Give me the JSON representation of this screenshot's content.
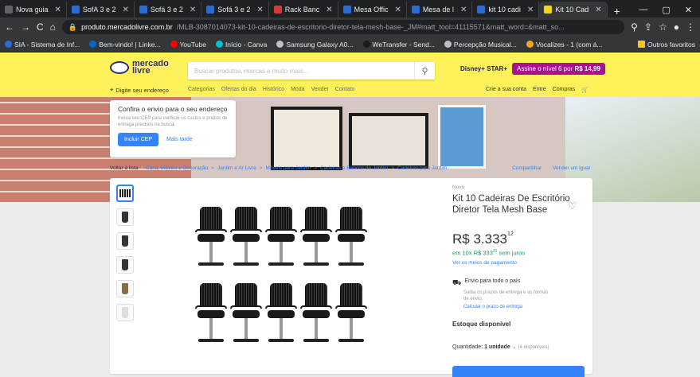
{
  "browser": {
    "tabs": [
      {
        "label": "Nova guia",
        "color": "#5f6368"
      },
      {
        "label": "SofA 3 e 2",
        "color": "#2b6bd6"
      },
      {
        "label": "Sofá 3 e 2",
        "color": "#2b6bd6"
      },
      {
        "label": "Sofá 3 e 2",
        "color": "#2b6bd6"
      },
      {
        "label": "Rack Banc",
        "color": "#d43c3c"
      },
      {
        "label": "Mesa Offic",
        "color": "#2b6bd6"
      },
      {
        "label": "Mesa de l",
        "color": "#2b6bd6"
      },
      {
        "label": "kit 10 cadi",
        "color": "#2b6bd6"
      },
      {
        "label": "Kit 10 Cad",
        "color": "#f5d21c"
      }
    ],
    "new_tab": "+",
    "url_domain": "produto.mercadolivre.com.br",
    "url_path": "/MLB-3087014073-kit-10-cadeiras-de-escritorio-diretor-tela-mesh-base-_JM#matt_tool=41115571&matt_word=&matt_so...",
    "bookmarks": [
      {
        "label": "SIA - Sistema de Inf...",
        "color": "#2b6bd6"
      },
      {
        "label": "Bem-vindo! | Linke...",
        "color": "#0a66c2"
      },
      {
        "label": "YouTube",
        "color": "#ff0000"
      },
      {
        "label": "Início - Canva",
        "color": "#00c4cc"
      },
      {
        "label": "Samsung Galaxy A0...",
        "color": "#bdc1c6"
      },
      {
        "label": "WeTransfer - Send...",
        "color": "#1a1a1a"
      },
      {
        "label": "Percepção Musical...",
        "color": "#bdc1c6"
      },
      {
        "label": "Vocalizes - 1 (com á...",
        "color": "#f5a623"
      }
    ],
    "other_favorites": "Outros favoritos"
  },
  "header": {
    "logo_line1": "mercado",
    "logo_line2": "livre",
    "search_placeholder": "Buscar produtos, marcas e muito mais...",
    "disney_label": "Disney+ STAR+",
    "promo_label": "Assine o nível 6 por ",
    "promo_price": "R$ 14,99",
    "location": "Digite seu endereço",
    "nav": [
      "Categorias",
      "Ofertas do dia",
      "Histórico",
      "Moda",
      "Vender",
      "Contato"
    ],
    "user": [
      "Crie a sua conta",
      "Entre",
      "Compras"
    ]
  },
  "cep_card": {
    "title": "Confira o envio para o seu endereço",
    "text": "Inclua seu CEP para verificar os custos e prazos de entrega precisos na busca.",
    "primary": "Incluir CEP",
    "secondary": "Mais tarde"
  },
  "breadcrumb": {
    "back": "Voltar à lista",
    "items": [
      "Casa, Móveis e Decoração",
      "Jardim e Ar Livre",
      "Móveis para Jardim",
      "Cadeiras e Bancos de Jardim",
      "Cadeiras para Jardim"
    ],
    "share": "Compartilhar",
    "sell": "Vender um igual"
  },
  "product": {
    "condition": "Novo",
    "title": "Kit 10 Cadeiras De Escritório Diretor Tela Mesh Base",
    "price": "R$ 3.333",
    "price_cents": "12",
    "installments": "em 10x R$ 333",
    "installments_cents": "31",
    "installments_suffix": " sem juros",
    "payment_link": "Ver os meios de pagamento",
    "shipping": "Envio para todo o país",
    "shipping_sub": "Saiba os prazos de entrega e as formas de envio.",
    "shipping_calc": "Calcular o prazo de entrega",
    "stock": "Estoque disponível",
    "quantity_label": "Quantidade: ",
    "quantity_value": "1 unidade",
    "quantity_avail": "(4 disponíveis)"
  }
}
